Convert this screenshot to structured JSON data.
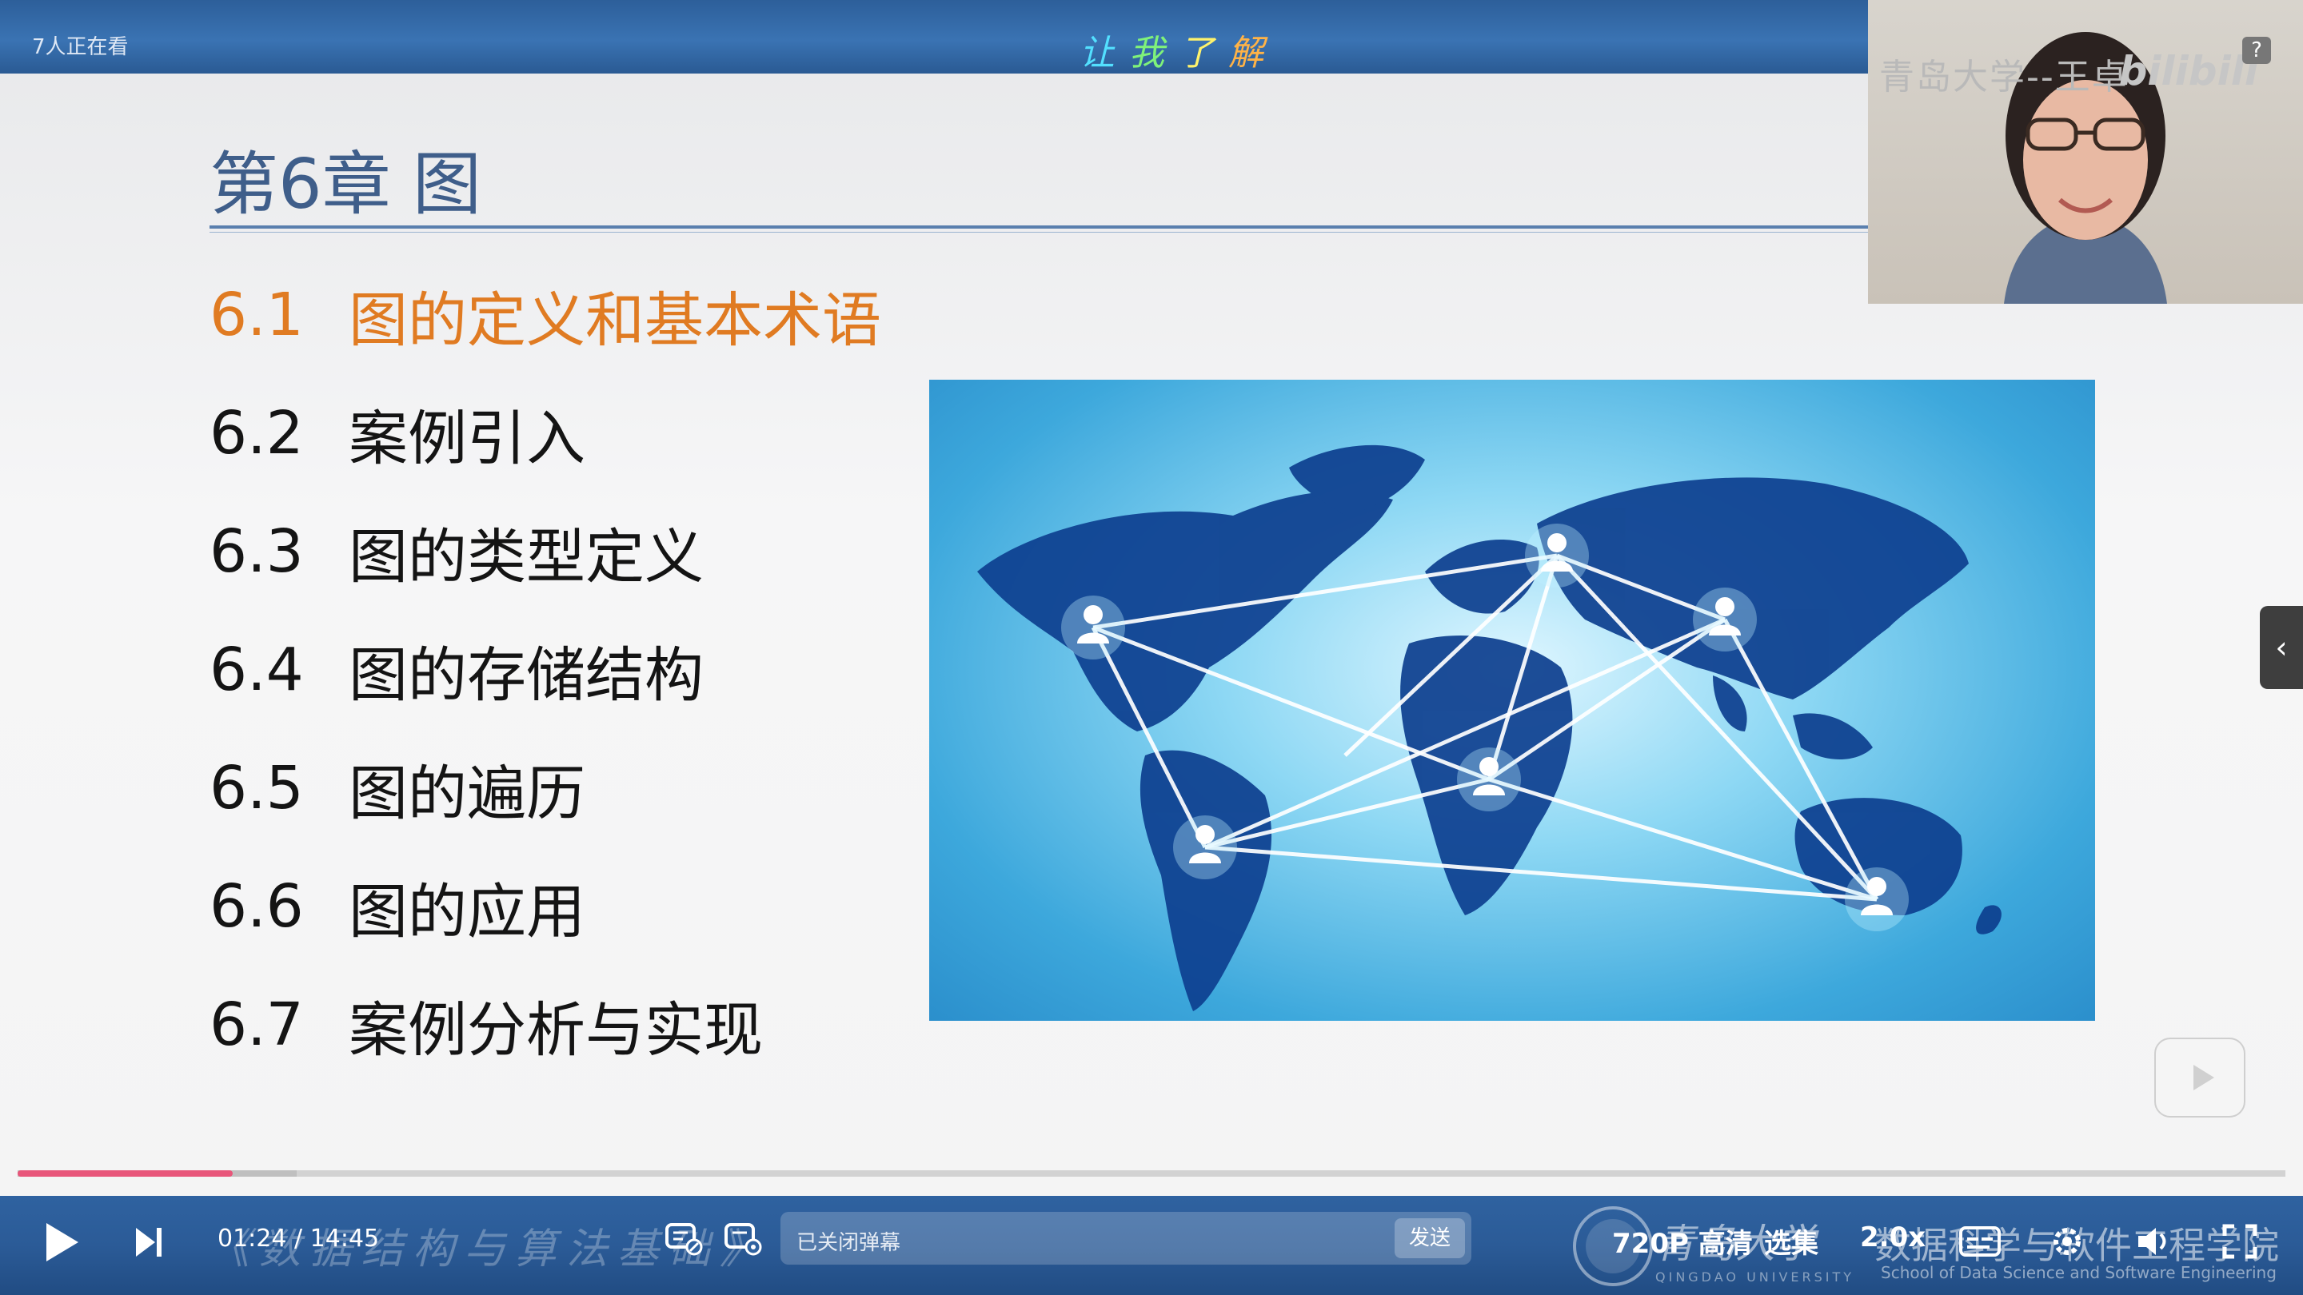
{
  "header": {
    "viewers": "7人正在看",
    "slogan": [
      "让",
      "我",
      "了",
      "解"
    ]
  },
  "slide": {
    "chapter_title": "第6章 图",
    "toc": [
      {
        "num": "6.1",
        "label": "图的定义和基本术语",
        "active": true
      },
      {
        "num": "6.2",
        "label": "案例引入",
        "active": false
      },
      {
        "num": "6.3",
        "label": "图的类型定义",
        "active": false
      },
      {
        "num": "6.4",
        "label": "图的存储结构",
        "active": false
      },
      {
        "num": "6.5",
        "label": "图的遍历",
        "active": false
      },
      {
        "num": "6.6",
        "label": "图的应用",
        "active": false
      },
      {
        "num": "6.7",
        "label": "案例分析与实现",
        "active": false
      }
    ]
  },
  "webcam": {
    "caption": "青岛大学--王卓",
    "logo": "bilibili",
    "help": "?"
  },
  "player": {
    "current_time": "01:24",
    "separator": "/",
    "total_time": "14:45",
    "progress_percent": 9.5,
    "buffer_percent": 12.3,
    "course_watermark": "《数据结构与算法基础》",
    "danmaku_placeholder": "已关闭弹幕",
    "send_label": "发送",
    "quality": "720P 高清",
    "episodes": "选集",
    "speed": "2.0x",
    "university": "青岛大学",
    "university_en": "QINGDAO UNIVERSITY",
    "college": "数据科学与软件工程学院",
    "college_en": "School of Data Science and Software Engineering"
  },
  "colors": {
    "accent": "#e07b22",
    "title": "#3f5e8a",
    "progress": "#e8567a",
    "bar": "#2f62a0"
  }
}
